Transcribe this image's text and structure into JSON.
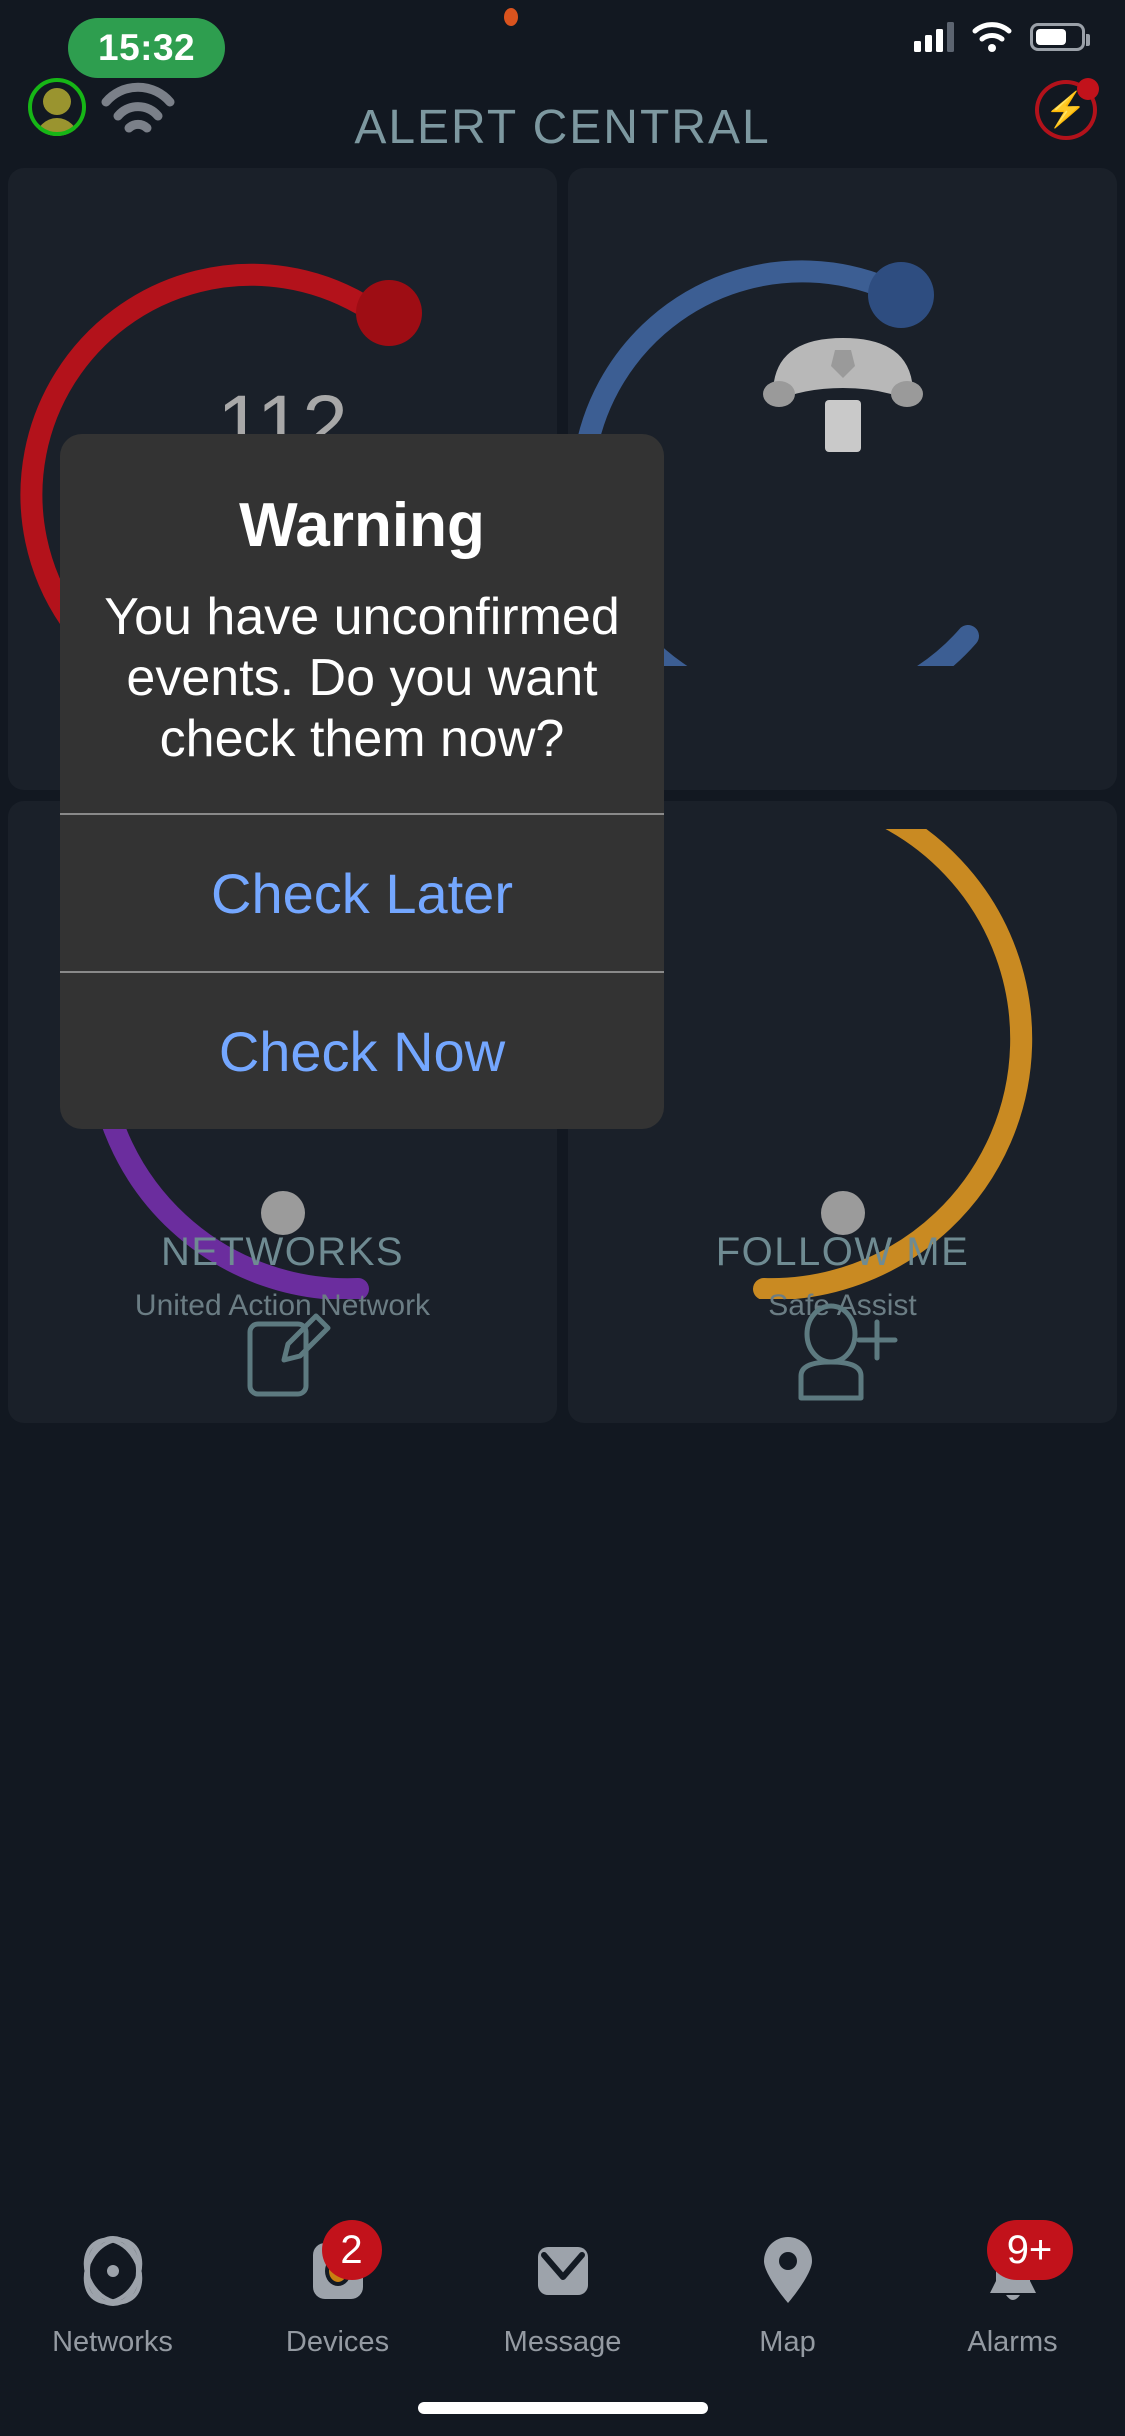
{
  "status_bar": {
    "time": "15:32",
    "recording_indicator": "record-dot",
    "signal_icon": "cellular-signal-icon",
    "wifi_icon": "wifi-icon",
    "battery_icon": "battery-icon",
    "battery_level_pct": 62
  },
  "header": {
    "title": "ALERT CENTRAL",
    "settings_label": "Settings",
    "settings_icon": "user-avatar-icon",
    "connection_icon": "wifi-signal-icon",
    "alert_label": "Alert Central",
    "alert_icon": "lightning-bolt-icon",
    "title_color": "#7d98a0"
  },
  "cards": [
    {
      "id": "emergency",
      "value": "112",
      "arc_color": "#b3121b",
      "knob_color": "#9e0d14",
      "icon": "number-display"
    },
    {
      "id": "police",
      "value": "",
      "arc_color": "#3c5e93",
      "knob_color": "#2e4d80",
      "icon": "police-cap-icon"
    },
    {
      "id": "networks",
      "title": "NETWORKS",
      "subtitle": "United Action Network",
      "arc_color": "#6b2d9e",
      "knob_color": "#9b9b9b",
      "icon": "edit-document-icon"
    },
    {
      "id": "follow-me",
      "title": "FOLLOW ME",
      "subtitle": "Safe Assist",
      "arc_color": "#c98a22",
      "knob_color": "#9b9b9b",
      "icon": "add-person-icon"
    }
  ],
  "dialog": {
    "title": "Warning",
    "message": "You have unconfirmed events. Do you want check them now?",
    "buttons": [
      {
        "label": "Check Later",
        "color": "#74a7ff"
      },
      {
        "label": "Check Now",
        "color": "#74a7ff"
      }
    ],
    "background": "#333333"
  },
  "tabbar": {
    "items": [
      {
        "label": "Networks",
        "icon": "network-globe-icon",
        "badge": ""
      },
      {
        "label": "Devices",
        "icon": "device-icon",
        "badge": "2"
      },
      {
        "label": "Message",
        "icon": "envelope-icon",
        "badge": ""
      },
      {
        "label": "Map",
        "icon": "map-pin-icon",
        "badge": ""
      },
      {
        "label": "Alarms",
        "icon": "bell-icon",
        "badge": "9+"
      }
    ],
    "badge_color": "#c2121b"
  }
}
